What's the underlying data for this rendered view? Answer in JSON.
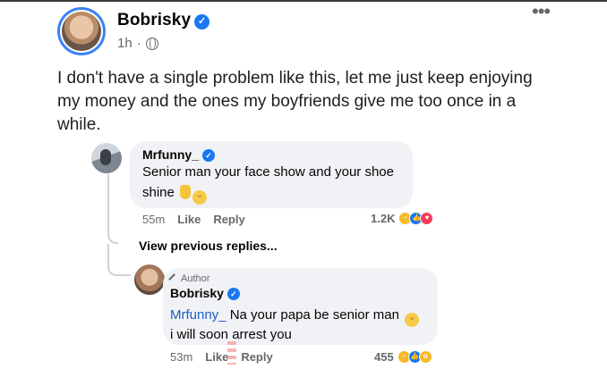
{
  "post": {
    "author": "Bobrisky",
    "time": "1h",
    "dot": "·",
    "text": "I don't have a single problem like this, let me just keep enjoying my money and the ones my boyfriends give me too once in a while.",
    "more_icon": "more-horizontal-icon"
  },
  "comments": [
    {
      "author": "Mrfunny_",
      "text_line1": "Senior man your face show and your shoe",
      "text_line2": "shine",
      "emojis": [
        "victory-hand",
        "grinning-face"
      ],
      "time": "55m",
      "like_label": "Like",
      "reply_label": "Reply",
      "reaction_count": "1.2K",
      "reaction_icons": [
        "haha",
        "like",
        "love"
      ]
    }
  ],
  "view_previous_replies": "View previous replies...",
  "reply": {
    "badge": "Author",
    "author": "Bobrisky",
    "mention": "Mrfunny_",
    "text_line1": " Na your papa be senior man",
    "text_line2": "i will soon arrest you",
    "time": "53m",
    "like_label": "Like",
    "reply_label": "Reply",
    "reaction_count": "455",
    "reaction_icons": [
      "haha",
      "like",
      "wow"
    ]
  },
  "colors": {
    "verified": "#1877f2",
    "mention": "#1d5fc6",
    "bubble": "#f0f2f5",
    "meta_text": "#65676b"
  }
}
